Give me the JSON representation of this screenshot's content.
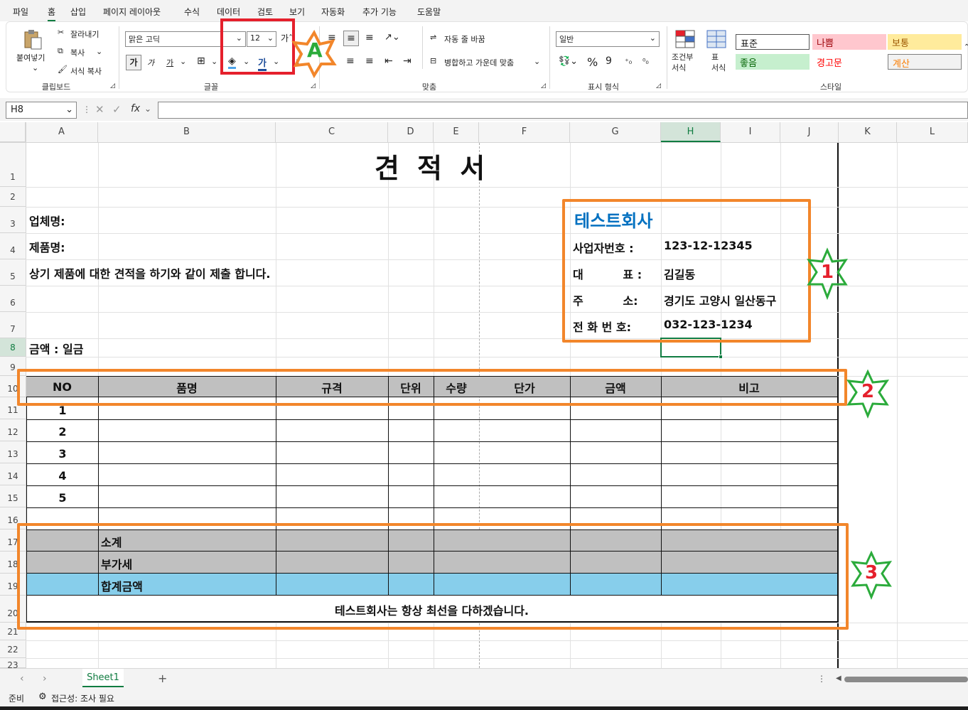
{
  "menu": [
    "파일",
    "홈",
    "삽입",
    "페이지 레이아웃",
    "수식",
    "데이터",
    "검토",
    "보기",
    "자동화",
    "추가 기능",
    "도움말"
  ],
  "ribbon": {
    "paste": "붙여넣기",
    "cut": "잘라내기",
    "copy": "복사",
    "format_painter": "서식 복사",
    "clipboard": "클립보드",
    "font_group": "글꼴",
    "align_group": "맞춤",
    "number_group": "표시 형식",
    "style_group": "스타일",
    "font_name": "맑은 고딕",
    "font_size": "12",
    "bold": "가",
    "italic": "가",
    "underline": "가",
    "wrap": "자동 줄 바꿈",
    "merge": "병합하고 가운데 맞춤",
    "number_format": "일반",
    "cond_format": "조건부\n서식",
    "table_format": "표\n서식",
    "styles": [
      {
        "label": "표준",
        "bg": "#ffffff",
        "fg": "#111111"
      },
      {
        "label": "나쁨",
        "bg": "#ffc7ce",
        "fg": "#9c0006"
      },
      {
        "label": "보통",
        "bg": "#ffeb9c",
        "fg": "#9c5700"
      },
      {
        "label": "좋음",
        "bg": "#c6efce",
        "fg": "#006100"
      },
      {
        "label": "경고문",
        "bg": "#ffffff",
        "fg": "#ff0000"
      },
      {
        "label": "계산",
        "bg": "#f2f2f2",
        "fg": "#fa7d00"
      }
    ]
  },
  "formula": {
    "namebox": "H8",
    "fx": "fx",
    "value": ""
  },
  "columns": [
    "A",
    "B",
    "C",
    "D",
    "E",
    "F",
    "G",
    "H",
    "I",
    "J",
    "K",
    "L"
  ],
  "rows": [
    "1",
    "2",
    "3",
    "4",
    "5",
    "6",
    "7",
    "8",
    "9",
    "10",
    "11",
    "12",
    "13",
    "14",
    "15",
    "16",
    "17",
    "18",
    "19",
    "20",
    "21",
    "22",
    "23"
  ],
  "sheet": {
    "title": "견 적 서",
    "company_label": "업체명:",
    "product_label": "제품명:",
    "notice": "상기 제품에 대한 견적을 하기와 같이 제출 합니다.",
    "amount_label": "금액 : 일금",
    "company_name": "테스트회사",
    "info": [
      {
        "label": "사업자번호 :",
        "value": "123-12-12345"
      },
      {
        "label": "대          표 :",
        "value": "김길동"
      },
      {
        "label": "주          소:",
        "value": "경기도 고양시 일산동구"
      },
      {
        "label": "전 화 번 호:",
        "value": "032-123-1234"
      }
    ],
    "headers": [
      "NO",
      "품명",
      "규격",
      "단위",
      "수량",
      "단가",
      "금액",
      "비고"
    ],
    "numbers": [
      "1",
      "2",
      "3",
      "4",
      "5"
    ],
    "subtotal": "소계",
    "vat": "부가세",
    "total": "합계금액",
    "footer": "테스트회사는 항상 최선을 다하겠습니다."
  },
  "annotations": {
    "a": "A",
    "one": "1",
    "two": "2",
    "three": "3"
  },
  "tabs": {
    "sheet1": "Sheet1",
    "add": "+"
  },
  "status": {
    "ready": "준비",
    "accessibility": "접근성: 조사 필요"
  },
  "colors": {
    "orange": "#f2862b",
    "green": "#2bab3b",
    "red": "#e5202c",
    "gray": "#c0c0c0",
    "blue": "#87ceeb",
    "accent": "#0070c0"
  }
}
